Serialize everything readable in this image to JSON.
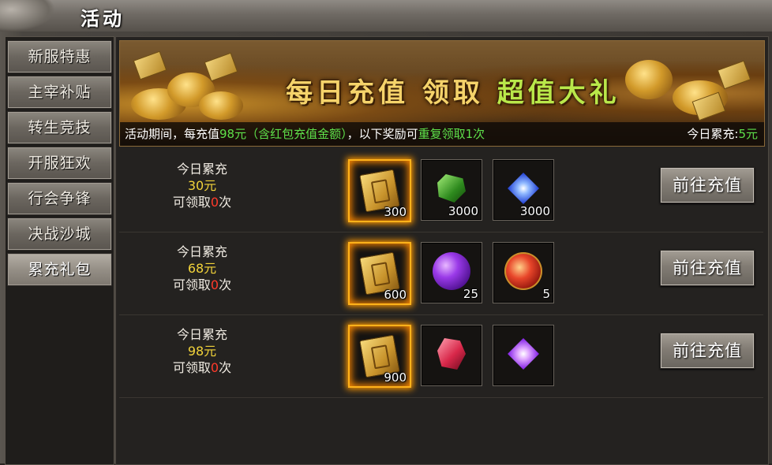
{
  "window": {
    "title": "活动"
  },
  "sidebar": {
    "items": [
      {
        "label": "新服特惠"
      },
      {
        "label": "主宰补贴"
      },
      {
        "label": "转生竞技"
      },
      {
        "label": "开服狂欢"
      },
      {
        "label": "行会争锋"
      },
      {
        "label": "决战沙城"
      },
      {
        "label": "累充礼包",
        "active": true
      }
    ]
  },
  "banner": {
    "title_part1": "每日充值 领取",
    "title_part2": "超值大礼",
    "desc_prefix": "活动期间，每充值",
    "desc_amount": "98元（含红包充值金额）",
    "desc_mid": "，以下奖励可",
    "desc_repeat": "重复领取1次",
    "today_label": "今日累充:",
    "today_value": "5元"
  },
  "rows": [
    {
      "label": "今日累充",
      "amount": "30元",
      "claim_prefix": "可领取",
      "claim_count": "0",
      "claim_suffix": "次",
      "items": [
        {
          "icon": "gold-ticket-icon",
          "count": "300"
        },
        {
          "icon": "green-gem-icon",
          "count": "3000"
        },
        {
          "icon": "blue-crystal-icon",
          "count": "3000"
        }
      ],
      "button": "前往充值"
    },
    {
      "label": "今日累充",
      "amount": "68元",
      "claim_prefix": "可领取",
      "claim_count": "0",
      "claim_suffix": "次",
      "items": [
        {
          "icon": "gold-ticket-icon",
          "count": "600"
        },
        {
          "icon": "purple-orb-icon",
          "count": "25"
        },
        {
          "icon": "red-orb-icon",
          "count": "5"
        }
      ],
      "button": "前往充值"
    },
    {
      "label": "今日累充",
      "amount": "98元",
      "claim_prefix": "可领取",
      "claim_count": "0",
      "claim_suffix": "次",
      "items": [
        {
          "icon": "gold-ticket-icon",
          "count": "900"
        },
        {
          "icon": "red-gem-icon",
          "count": ""
        },
        {
          "icon": "purple-crystal-icon",
          "count": ""
        }
      ],
      "button": "前往充值"
    }
  ],
  "colors": {
    "highlight_green": "#5ee04a",
    "amount_yellow": "#f2d33a",
    "count_red": "#ff3a2a",
    "slot_glow": "#ffb21a"
  }
}
